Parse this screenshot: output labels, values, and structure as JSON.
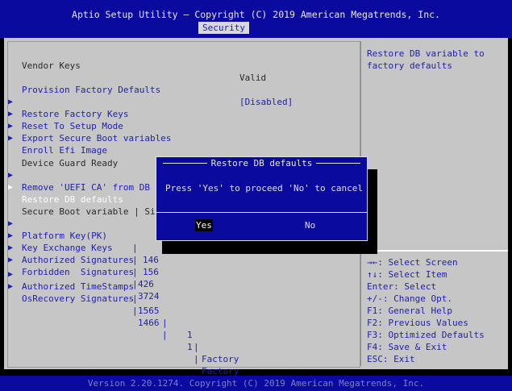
{
  "header": {
    "title": "Aptio Setup Utility – Copyright (C) 2019 American Megatrends, Inc.",
    "active_tab": "Security"
  },
  "menu": [
    {
      "label": "Vendor Keys",
      "value": "Valid",
      "type": "static"
    },
    {
      "label": "Provision Factory Defaults",
      "value": "[Disabled]",
      "type": "option"
    },
    {
      "label": "Restore Factory Keys",
      "type": "submenu"
    },
    {
      "label": "Reset To Setup Mode",
      "type": "submenu"
    },
    {
      "label": "Export Secure Boot variables",
      "type": "submenu"
    },
    {
      "label": "Enroll Efi Image",
      "type": "submenu"
    },
    {
      "label": "Device Guard Ready",
      "type": "static"
    },
    {
      "label": "Remove 'UEFI CA' from DB",
      "type": "submenu"
    },
    {
      "label": "Restore DB defaults",
      "type": "submenu",
      "selected": true
    }
  ],
  "secure_boot_table": {
    "header": "Secure Boot variable | Siz",
    "rows": [
      {
        "name": "Platform Key(PK)",
        "size": "146"
      },
      {
        "name": "Key Exchange Keys",
        "size": "156"
      },
      {
        "name": "Authorized Signatures",
        "size": "426"
      },
      {
        "name": "Forbidden  Signatures",
        "size": "3724"
      },
      {
        "name": "Authorized TimeStamps",
        "size": "1565",
        "count": "1",
        "source": "Factory"
      },
      {
        "name": "OsRecovery Signatures",
        "size": "1466",
        "count": "1",
        "source": "Factory"
      }
    ]
  },
  "help_text": "Restore DB variable to factory defaults",
  "key_help": [
    "→←: Select Screen",
    "↑↓: Select Item",
    "Enter: Select",
    "+/-: Change Opt.",
    "F1: General Help",
    "F2: Previous Values",
    "F3: Optimized Defaults",
    "F4: Save & Exit",
    "ESC: Exit"
  ],
  "dialog": {
    "title": "Restore DB defaults",
    "message": "Press 'Yes' to proceed 'No' to cancel",
    "yes_label": "Yes",
    "no_label": "No"
  },
  "footer": "Version 2.20.1274. Copyright (C) 2019 American Megatrends, Inc.",
  "colors": {
    "bios_blue": "#0a0a9e",
    "panel_gray": "#c6c6c6",
    "link_blue": "#1f1fa8"
  }
}
